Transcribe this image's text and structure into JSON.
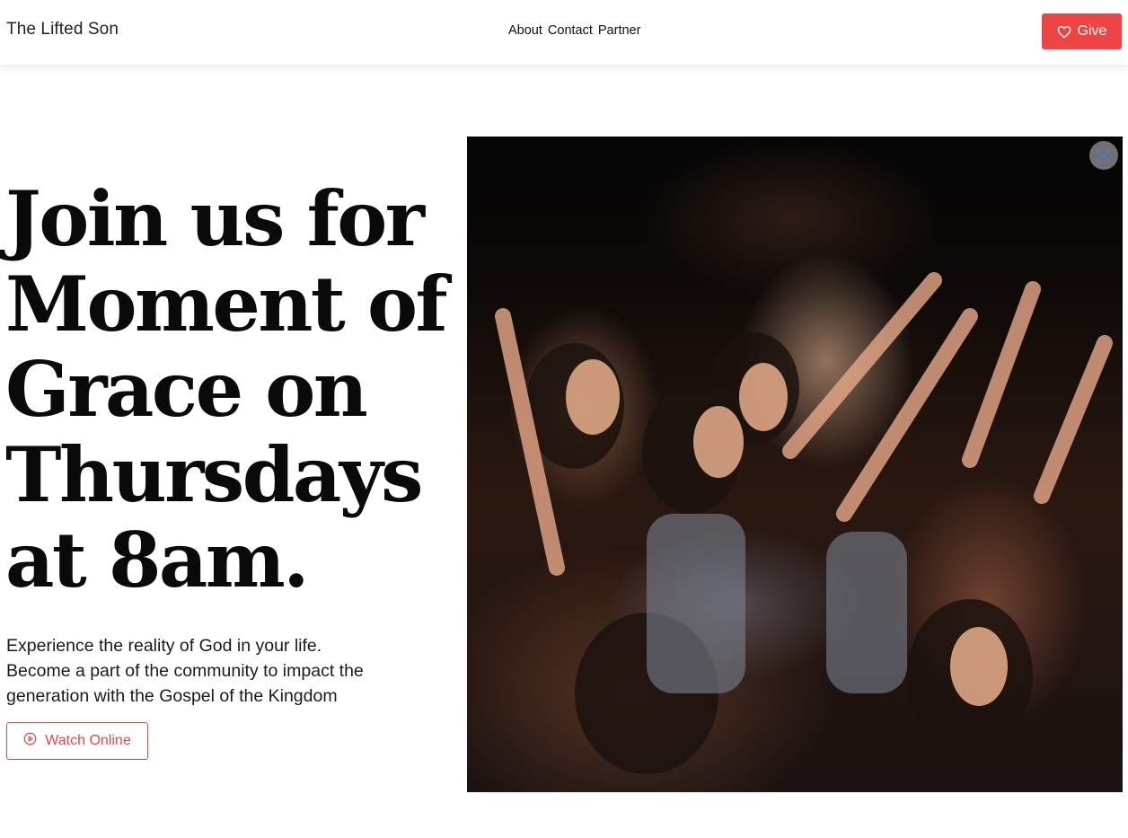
{
  "header": {
    "brand": "The Lifted Son",
    "nav": [
      "About",
      "Contact",
      "Partner"
    ],
    "give_label": "Give"
  },
  "hero": {
    "headline_lines": [
      "Join us for",
      "Moment of",
      "Grace on",
      "Thursdays",
      "at 8am."
    ],
    "subtitle_lines": [
      "Experience the reality of God in your life.",
      "Become a part of the community to impact the",
      "generation with the Gospel of the Kingdom"
    ],
    "watch_label": "Watch Online",
    "image_icon": "lens-search-icon"
  },
  "colors": {
    "accent": "#ef4444",
    "text": "#111111",
    "background": "#ffffff"
  },
  "icons": {
    "give": "heart-icon",
    "watch": "play-circle-icon"
  }
}
